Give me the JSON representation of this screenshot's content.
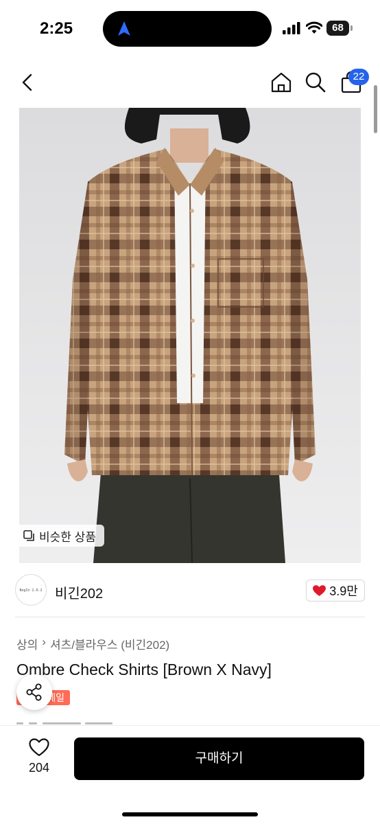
{
  "status_bar": {
    "time": "2:25",
    "battery": "68"
  },
  "nav": {
    "back_icon": "chevron-left-icon",
    "home_icon": "home-icon",
    "search_icon": "search-icon",
    "cart_icon": "shopping-bag-icon",
    "cart_badge": "22"
  },
  "image": {
    "similar_button": "비슷한 상품"
  },
  "seller": {
    "name": "비긴202",
    "logo_text": "BegIn 2.0.2",
    "likes": "3.9만"
  },
  "product": {
    "breadcrumb": [
      "상의",
      "셔츠/블라우스 (비긴202)"
    ],
    "title": "Ombre Check Shirts [Brown X Navy]",
    "badge": "세일"
  },
  "bottom_bar": {
    "wishlist_count": "204",
    "buy_label": "구매하기"
  },
  "colors": {
    "accent": "#2563eb",
    "heart": "#e0192b",
    "buy_button": "#000000",
    "sale_badge": "#ff6b57"
  }
}
